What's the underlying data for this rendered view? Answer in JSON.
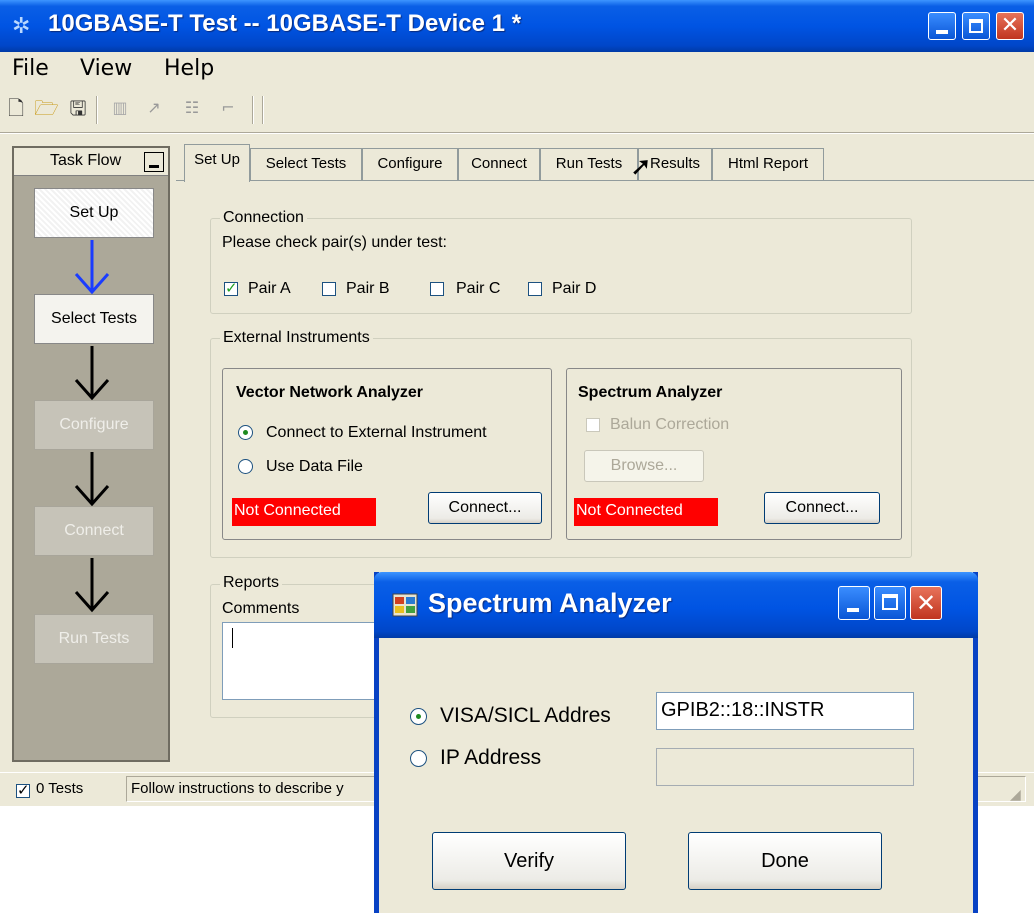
{
  "window": {
    "title": "10GBASE-T Test -- 10GBASE-T Device 1 *"
  },
  "menu": [
    "File",
    "View",
    "Help"
  ],
  "taskflow": {
    "title": "Task Flow",
    "steps": [
      "Set Up",
      "Select Tests",
      "Configure",
      "Connect",
      "Run Tests"
    ]
  },
  "tabs": [
    "Set Up",
    "Select Tests",
    "Configure",
    "Connect",
    "Run Tests",
    "Results",
    "Html Report"
  ],
  "connection": {
    "legend": "Connection",
    "instruction": "Please check pair(s) under test:",
    "pairs": [
      {
        "label": "Pair A",
        "checked": true
      },
      {
        "label": "Pair B",
        "checked": false
      },
      {
        "label": "Pair C",
        "checked": false
      },
      {
        "label": "Pair D",
        "checked": false
      }
    ]
  },
  "external": {
    "legend": "External Instruments",
    "vna": {
      "title": "Vector Network Analyzer",
      "option_external": "Connect to External Instrument",
      "option_file": "Use Data File",
      "status": "Not Connected",
      "connect_button": "Connect..."
    },
    "spectrum": {
      "title": "Spectrum Analyzer",
      "balun": "Balun Correction",
      "browse_button": "Browse...",
      "status": "Not Connected",
      "connect_button": "Connect..."
    }
  },
  "reports": {
    "legend": "Reports",
    "comments_label": "Comments"
  },
  "statusbar": {
    "tests": "0 Tests",
    "message": "Follow instructions to describe y"
  },
  "dialog": {
    "title": "Spectrum Analyzer",
    "visa_label": "VISA/SICL Addres",
    "visa_value": "GPIB2::18::INSTR",
    "ip_label": "IP Address",
    "ip_value": "",
    "verify_button": "Verify",
    "done_button": "Done"
  },
  "colors": {
    "titlebar": "#0054e3",
    "not_connected": "#ff0000",
    "flow_active_arrow": "#1a3cff"
  }
}
